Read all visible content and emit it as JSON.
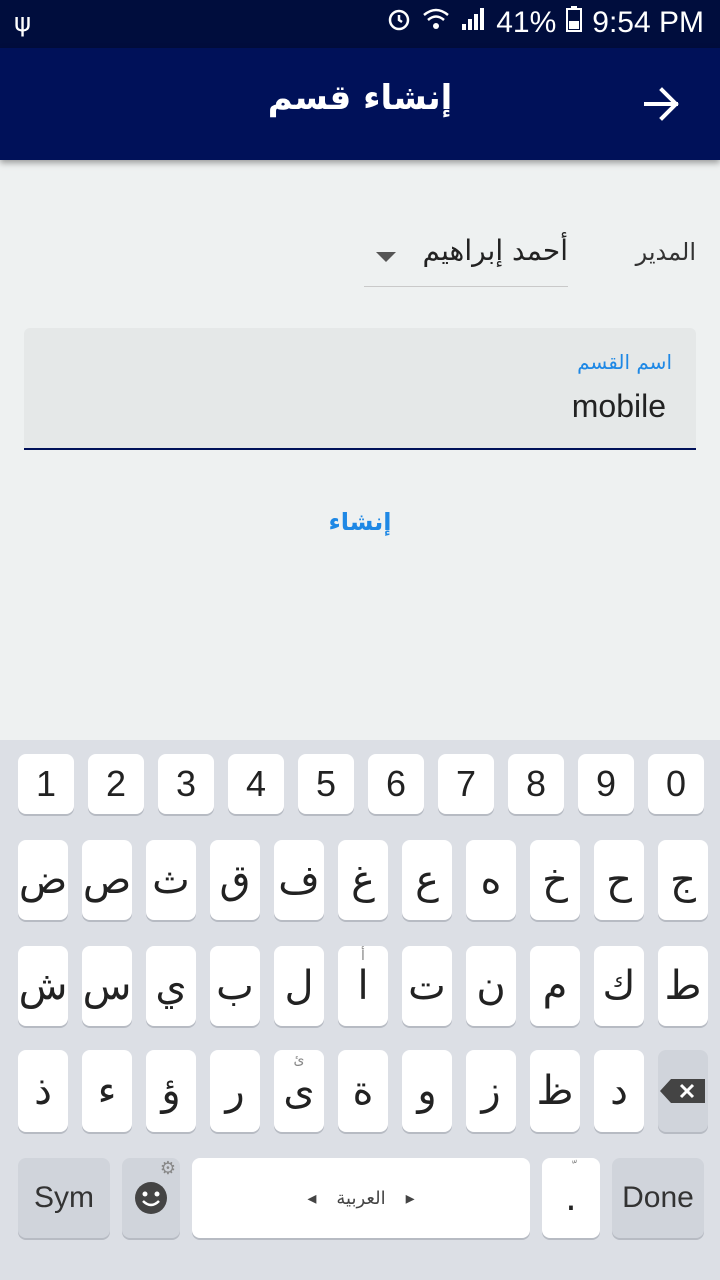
{
  "status": {
    "battery": "41%",
    "time": "9:54 PM"
  },
  "appbar": {
    "title": "إنشاء قسم"
  },
  "form": {
    "manager_label": "المدير",
    "manager_value": "أحمد إبراهيم",
    "section_label": "اسم القسم",
    "section_value": "mobile",
    "create_label": "إنشاء"
  },
  "keyboard": {
    "numbers": [
      "1",
      "2",
      "3",
      "4",
      "5",
      "6",
      "7",
      "8",
      "9",
      "0"
    ],
    "row1": [
      "ض",
      "ص",
      "ث",
      "ق",
      "ف",
      "غ",
      "ع",
      "ه",
      "خ",
      "ح",
      "ج"
    ],
    "row2": [
      "ش",
      "س",
      "ي",
      "ب",
      "ل",
      "ا",
      "ت",
      "ن",
      "م",
      "ك",
      "ط"
    ],
    "row2_hint": "أ",
    "row3": [
      "ذ",
      "ء",
      "ؤ",
      "ر",
      "ى",
      "ة",
      "و",
      "ز",
      "ظ",
      "د"
    ],
    "row3_hint": "ئ",
    "sym": "Sym",
    "space_label": "العربية",
    "period": ".",
    "period_hint": "ّ",
    "done": "Done"
  }
}
